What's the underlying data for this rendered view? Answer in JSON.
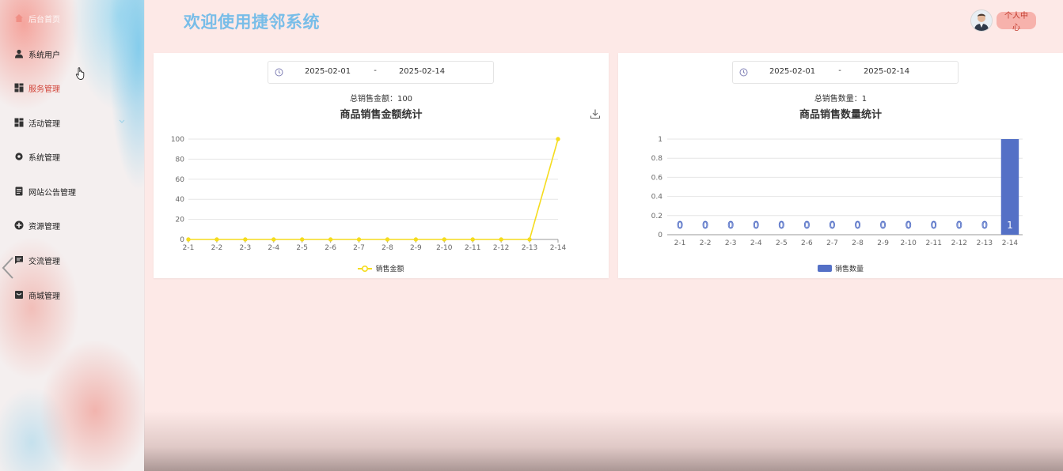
{
  "header": {
    "title": "欢迎使用捷邻系统",
    "profile_label": "个人中心"
  },
  "sidebar": {
    "items": [
      {
        "label": "后台首页",
        "icon": "home-icon"
      },
      {
        "label": "系统用户",
        "icon": "user-icon"
      },
      {
        "label": "服务管理",
        "icon": "dashboard-icon"
      },
      {
        "label": "活动管理",
        "icon": "dashboard-icon"
      },
      {
        "label": "系统管理",
        "icon": "gear-icon"
      },
      {
        "label": "网站公告管理",
        "icon": "document-icon"
      },
      {
        "label": "资源管理",
        "icon": "plus-circle-icon"
      },
      {
        "label": "交流管理",
        "icon": "chat-icon"
      },
      {
        "label": "商城管理",
        "icon": "shop-icon"
      }
    ]
  },
  "left_panel": {
    "start_date": "2025-02-01",
    "separator": "-",
    "end_date": "2025-02-14",
    "total_label": "总销售金额：100",
    "legend": "销售金额"
  },
  "right_panel": {
    "start_date": "2025-02-01",
    "separator": "-",
    "end_date": "2025-02-14",
    "total_label": "总销售数量：1",
    "legend": "销售数量"
  },
  "colors": {
    "line": "#f5dc1e",
    "bar": "#5470c6",
    "title": "#78bde8",
    "accent": "#d1453a"
  },
  "chart_data": [
    {
      "type": "line",
      "title": "商品销售金额统计",
      "categories": [
        "2-1",
        "2-2",
        "2-3",
        "2-4",
        "2-5",
        "2-6",
        "2-7",
        "2-8",
        "2-9",
        "2-10",
        "2-11",
        "2-12",
        "2-13",
        "2-14"
      ],
      "series": [
        {
          "name": "销售金额",
          "values": [
            0,
            0,
            0,
            0,
            0,
            0,
            0,
            0,
            0,
            0,
            0,
            0,
            0,
            100
          ]
        }
      ],
      "ylim": [
        0,
        100
      ],
      "yticks": [
        0,
        20,
        40,
        60,
        80,
        100
      ],
      "grid": true,
      "legend": "bottom-center"
    },
    {
      "type": "bar",
      "title": "商品销售数量统计",
      "categories": [
        "2-1",
        "2-2",
        "2-3",
        "2-4",
        "2-5",
        "2-6",
        "2-7",
        "2-8",
        "2-9",
        "2-10",
        "2-11",
        "2-12",
        "2-13",
        "2-14"
      ],
      "series": [
        {
          "name": "销售数量",
          "values": [
            0,
            0,
            0,
            0,
            0,
            0,
            0,
            0,
            0,
            0,
            0,
            0,
            0,
            1
          ]
        }
      ],
      "ylim": [
        0,
        1
      ],
      "yticks": [
        0,
        0.2,
        0.4,
        0.6,
        0.8,
        1
      ],
      "grid": true,
      "data_labels": true,
      "legend": "bottom-center"
    }
  ]
}
